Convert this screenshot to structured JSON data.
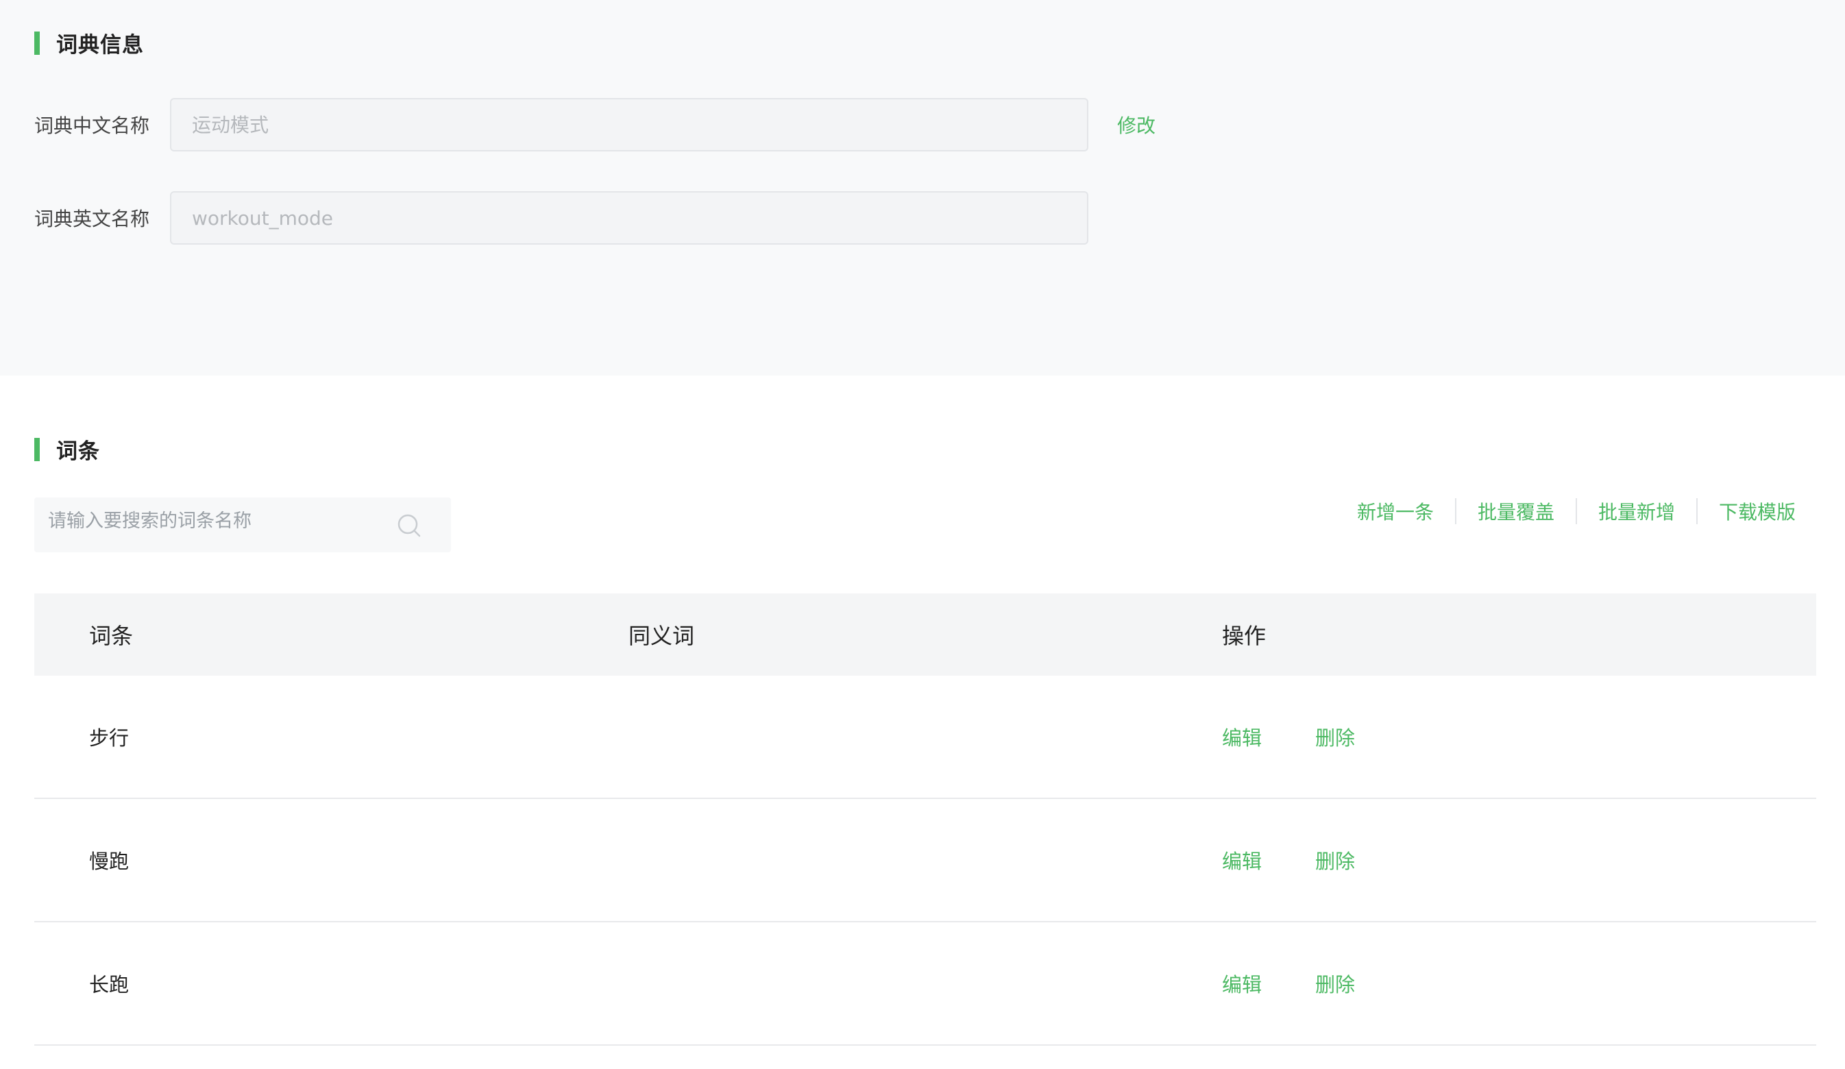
{
  "colors": {
    "accent": "#4cb963",
    "panel_background": "#f8f9fa",
    "table_header_background": "#f4f5f6"
  },
  "dictionary_info": {
    "title": "词典信息",
    "chinese_name": {
      "label": "词典中文名称",
      "placeholder": "运动模式",
      "edit_label": "修改"
    },
    "english_name": {
      "label": "词典英文名称",
      "placeholder": "workout_mode"
    }
  },
  "entries": {
    "title": "词条",
    "search": {
      "placeholder": "请输入要搜索的词条名称",
      "icon": "search-icon"
    },
    "toolbar": {
      "add_one": "新增一条",
      "batch_overwrite": "批量覆盖",
      "batch_add": "批量新增",
      "download_template": "下载模版"
    },
    "table": {
      "headers": [
        "词条",
        "同义词",
        "操作"
      ],
      "rows": [
        {
          "entry": "步行",
          "synonyms": "",
          "edit": "编辑",
          "delete": "删除"
        },
        {
          "entry": "慢跑",
          "synonyms": "",
          "edit": "编辑",
          "delete": "删除"
        },
        {
          "entry": "长跑",
          "synonyms": "",
          "edit": "编辑",
          "delete": "删除"
        }
      ]
    }
  }
}
